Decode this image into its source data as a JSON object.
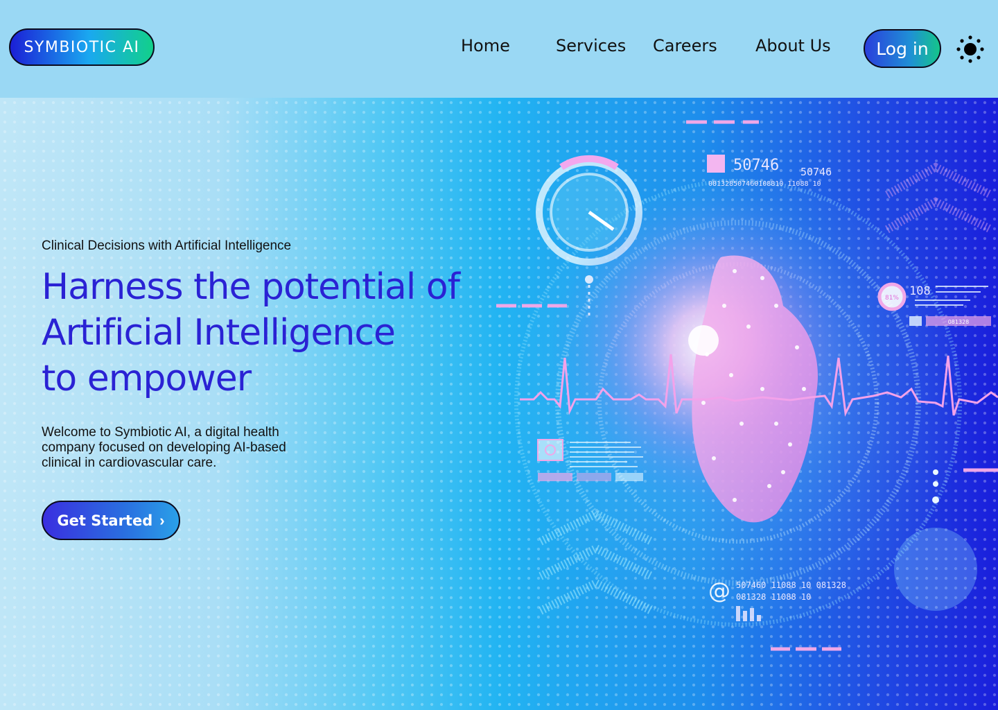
{
  "brand": {
    "logo_text": "SYMBIOTIC AI"
  },
  "nav": {
    "items": [
      {
        "label": "Home"
      },
      {
        "label": "Services"
      },
      {
        "label": "Careers"
      },
      {
        "label": "About Us"
      }
    ],
    "login_label": "Log in",
    "theme_icon": "sun-icon"
  },
  "hero": {
    "eyebrow": "Clinical Decisions with Artificial Intelligence",
    "headline_lines": [
      "Harness the potential of",
      "Artificial Intelligence",
      "to empower"
    ],
    "intro": "Welcome to Symbiotic AI, a digital health company focused on developing AI-based clinical in cardiovascular care.",
    "cta_label": "Get Started",
    "cta_icon": "chevron-right-icon",
    "image_readouts": {
      "code_large": "50746",
      "code_small": "50746",
      "code_strip": "081328507460108810 11088 10",
      "gauge_percent": "81%",
      "side_value": "108",
      "side_tag": "081328",
      "footer_code_1": "507460 11088 10 081328",
      "footer_code_2": "081328 11088 10"
    }
  },
  "colors": {
    "header_bg": "#9ad8f4",
    "headline": "#2a22d4",
    "hero_right": "#1a1edc",
    "accent_pink": "#f0a8e8"
  }
}
